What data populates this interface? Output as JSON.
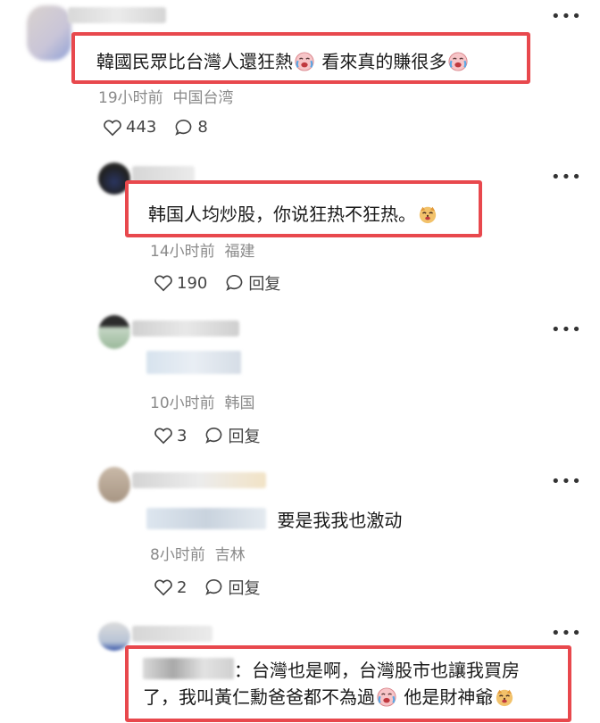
{
  "comments": [
    {
      "text_a": "韓國民眾比台灣人還狂熱",
      "text_b": " 看來真的賺很多",
      "time": "19小时前",
      "location": "中国台湾",
      "likes": "443",
      "replies": "8",
      "emoji_a": "crying-laugh-emoji",
      "emoji_b": "crying-laugh-emoji"
    },
    {
      "text": "韩国人均炒股，你说狂热不狂热。",
      "time": "14小时前",
      "location": "福建",
      "likes": "190",
      "reply_label": "回复",
      "emoji": "dog-face-emoji"
    },
    {
      "time": "10小时前",
      "location": "韩国",
      "likes": "3",
      "reply_label": "回复"
    },
    {
      "text": "要是我我也激动",
      "time": "8小时前",
      "location": "吉林",
      "likes": "2",
      "reply_label": "回复"
    },
    {
      "text_a": "：台灣也是啊，台灣股市也讓我買房",
      "text_b": "了，我叫黃仁勳爸爸都不為過",
      "text_c": " 他是財神爺",
      "emoji_a": "crying-laugh-emoji",
      "emoji_b": "dog-face-emoji"
    }
  ],
  "icons": {
    "more": "more-dots-icon",
    "like": "heart-outline-icon",
    "comment": "comment-bubble-icon"
  },
  "colors": {
    "highlight_border": "#e8484d",
    "meta_text": "#8a8a8a"
  }
}
